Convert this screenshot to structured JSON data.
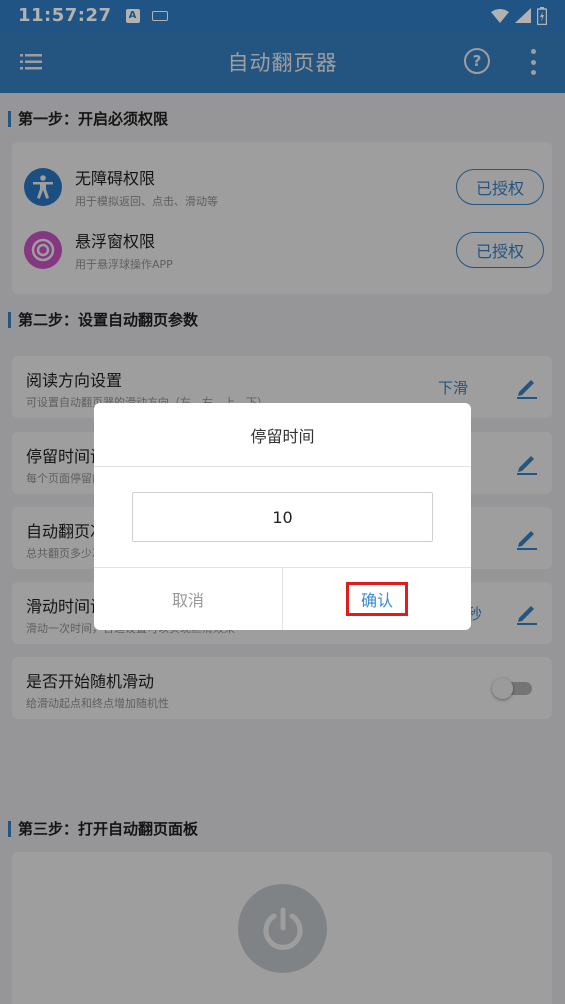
{
  "status_bar": {
    "time": "11:57:27",
    "a_badge": "A"
  },
  "app_bar": {
    "title": "自动翻页器",
    "help_glyph": "?"
  },
  "step1": {
    "title": "第一步：开启必须权限",
    "permissions": [
      {
        "title": "无障碍权限",
        "subtitle": "用于模拟返回、点击、滑动等",
        "button": "已授权"
      },
      {
        "title": "悬浮窗权限",
        "subtitle": "用于悬浮球操作APP",
        "button": "已授权"
      }
    ]
  },
  "step2": {
    "title": "第二步：设置自动翻页参数",
    "settings": [
      {
        "title": "阅读方向设置",
        "subtitle": "可设置自动翻页器的滑动方向（左、右、上、下）",
        "value": "下滑"
      },
      {
        "title": "停留时间设置",
        "subtitle": "每个页面停留的时间",
        "value": ""
      },
      {
        "title": "自动翻页次数",
        "subtitle": "总共翻页多少次",
        "value": ""
      },
      {
        "title": "滑动时间设置",
        "subtitle": "滑动一次时间，合适设置可以实现丝滑效果",
        "value": "秒"
      },
      {
        "title": "是否开始随机滑动",
        "subtitle": "给滑动起点和终点增加随机性",
        "toggle_on": false
      }
    ]
  },
  "step3": {
    "title": "第三步：打开自动翻页面板"
  },
  "dialog": {
    "title": "停留时间",
    "input_value": "10",
    "cancel": "取消",
    "confirm": "确认"
  },
  "colors": {
    "primary": "#3a8ad1",
    "status_bar": "#2f79bd",
    "accessibility_icon": "#2d7fd0",
    "overlay_icon": "#d85ad1",
    "highlight": "#e01c1c"
  }
}
